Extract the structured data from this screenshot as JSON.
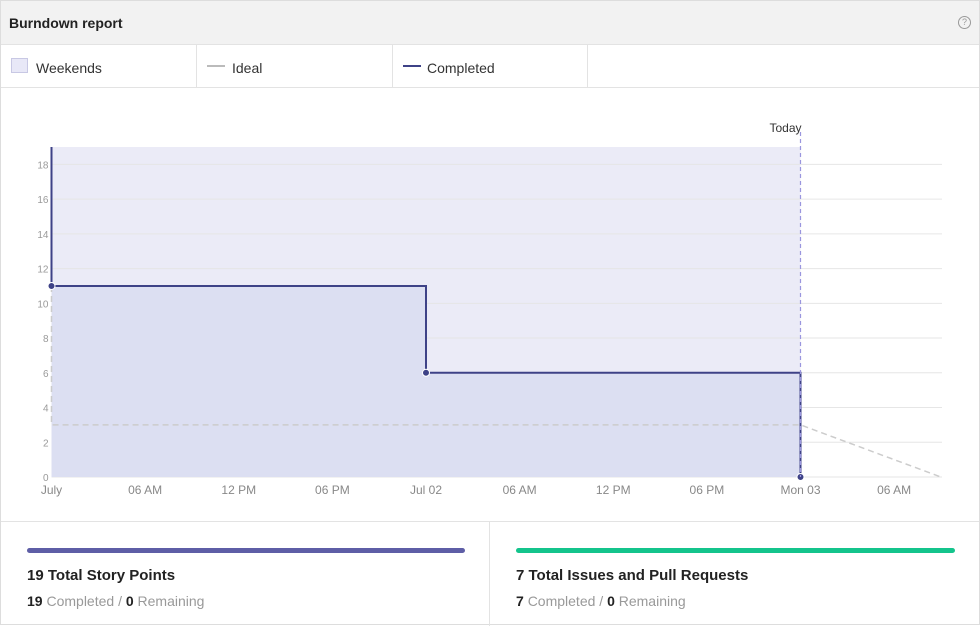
{
  "header": {
    "title": "Burndown report",
    "help_icon": "question-circle-icon",
    "help_glyph": "?"
  },
  "legend": {
    "weekends_label": "Weekends",
    "ideal_label": "Ideal",
    "completed_label": "Completed"
  },
  "colors": {
    "weekend_fill": "#ebebf7",
    "completed_line": "#3e4287",
    "completed_fill": "#dcdff2",
    "ideal_line": "#cccccc",
    "today_line": "#9a96de",
    "story_bar": "#5e5ea6",
    "issues_bar": "#14c48c"
  },
  "chart_data": {
    "type": "line",
    "title": "",
    "xlabel": "",
    "ylabel": "",
    "ylim": [
      0,
      19
    ],
    "yticks": [
      0,
      2,
      4,
      6,
      8,
      10,
      12,
      14,
      16,
      18
    ],
    "xtick_labels": [
      "July",
      "06 AM",
      "12 PM",
      "06 PM",
      "Jul 02",
      "06 AM",
      "12 PM",
      "06 PM",
      "Mon 03",
      "06 AM"
    ],
    "xlim_hours": [
      0,
      57
    ],
    "today_label": "Today",
    "today_hour": 48,
    "weekend_range_hours": [
      0,
      48
    ],
    "series": [
      {
        "name": "Completed",
        "style": "step",
        "points": [
          [
            0,
            19
          ],
          [
            0,
            11
          ],
          [
            24,
            11
          ],
          [
            24,
            6
          ],
          [
            48,
            6
          ],
          [
            48,
            0
          ]
        ],
        "markers": [
          [
            0,
            11
          ],
          [
            24,
            6
          ],
          [
            48,
            0
          ]
        ]
      },
      {
        "name": "Ideal",
        "style": "dashed",
        "points": [
          [
            0,
            11
          ],
          [
            0,
            3
          ],
          [
            48,
            3
          ],
          [
            57,
            0
          ]
        ]
      }
    ]
  },
  "stats": {
    "story": {
      "title": "19 Total Story Points",
      "completed": "19",
      "completed_label": "Completed",
      "sep": "/",
      "remaining": "0",
      "remaining_label": "Remaining",
      "progress": 1.0
    },
    "issues": {
      "title": "7 Total Issues and Pull Requests",
      "completed": "7",
      "completed_label": "Completed",
      "sep": "/",
      "remaining": "0",
      "remaining_label": "Remaining",
      "progress": 1.0
    }
  }
}
